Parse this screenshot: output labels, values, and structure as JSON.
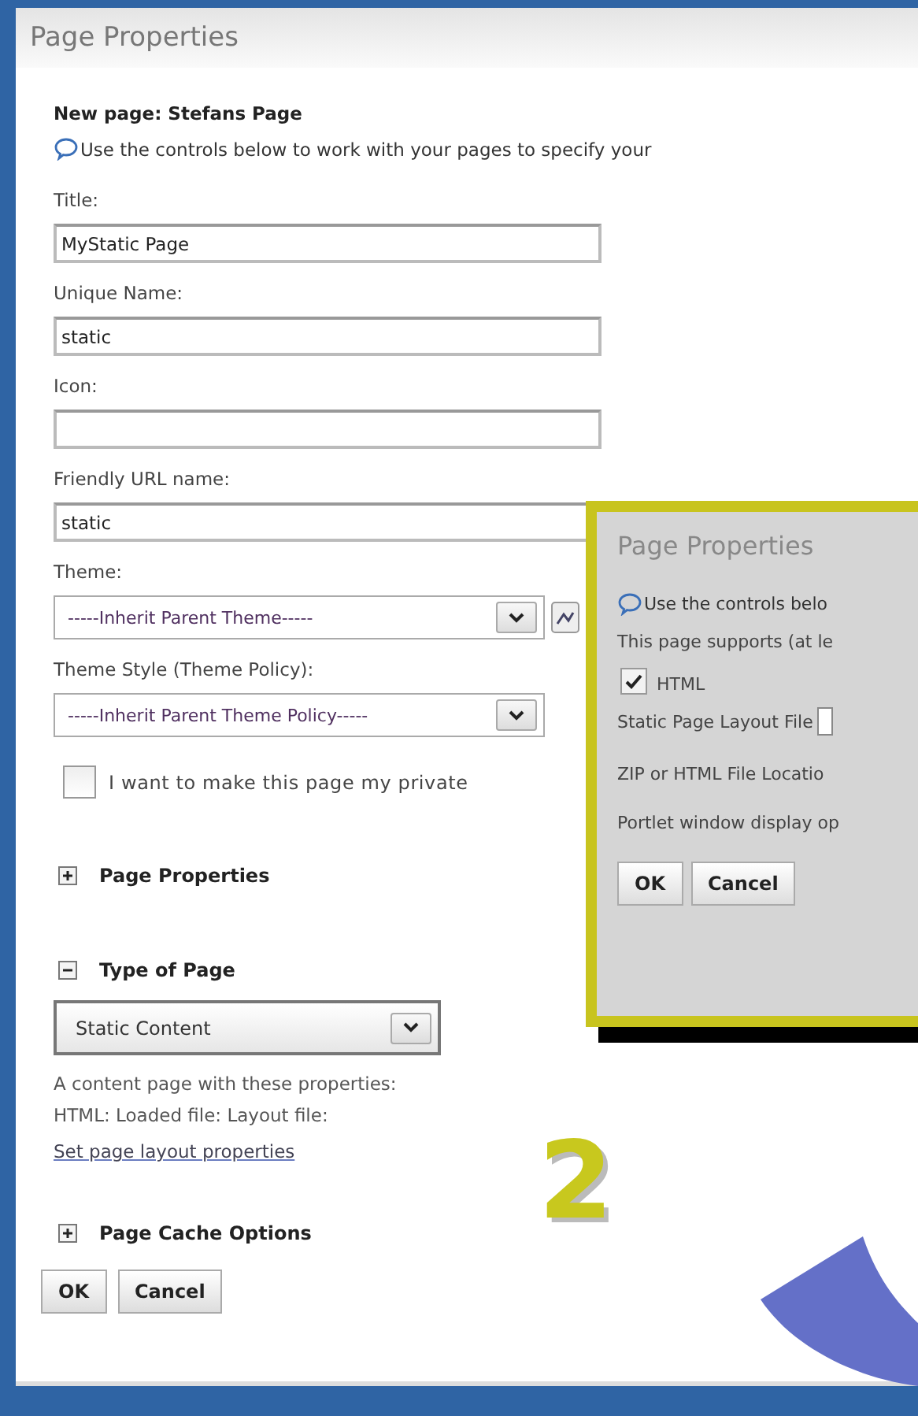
{
  "window": {
    "title": "Page Properties"
  },
  "heading": "New page: Stefans Page",
  "info": "Use the controls below to work with your pages to specify your",
  "fields": [
    {
      "label": "Title:",
      "kind": "text",
      "value": "MyStatic Page"
    },
    {
      "label": "Unique Name:",
      "kind": "text",
      "value": "static"
    },
    {
      "label": "Icon:",
      "kind": "text"
    },
    {
      "label": "Friendly URL name:",
      "kind": "text",
      "value": "static"
    },
    {
      "label": "Theme:",
      "kind": "select-icon",
      "value": "-----Inherit Parent Theme-----"
    },
    {
      "label": "Theme Style (Theme Policy):",
      "kind": "select",
      "value": "-----Inherit Parent Theme Policy-----"
    }
  ],
  "private_checkbox": {
    "label": "I want to make this page my private",
    "checked": false
  },
  "sections": [
    {
      "label": "Page Properties",
      "expanded": false
    },
    {
      "label": "Type of Page",
      "expanded": true,
      "select": "Static Content",
      "description": [
        "A content page with these properties:",
        "HTML: Loaded file: Layout file:"
      ],
      "link": "Set page layout properties"
    },
    {
      "label": "Page Cache Options",
      "expanded": false
    }
  ],
  "buttons": [
    "OK",
    "Cancel"
  ],
  "inset": {
    "title": "Page Properties",
    "info": "Use the controls belo",
    "supports": "This page supports (at le",
    "checkbox": {
      "label": "HTML",
      "checked": true
    },
    "rows": [
      "Static Page Layout File",
      "ZIP or HTML File Locatio",
      "Portlet window display op"
    ],
    "buttons": [
      "OK",
      "Cancel"
    ]
  },
  "step_number": "2"
}
